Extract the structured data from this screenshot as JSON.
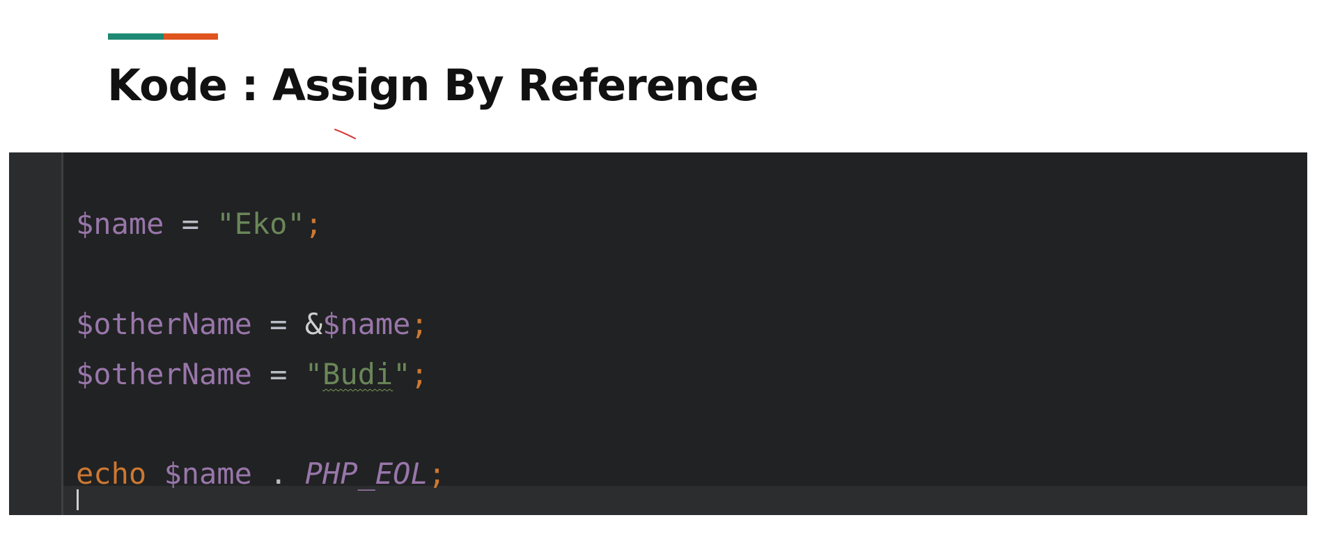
{
  "slide": {
    "title": "Kode : Assign By Reference",
    "accent_colors": [
      "#1f8a74",
      "#e0541f"
    ]
  },
  "editor": {
    "theme_bg": "#212223",
    "lines": [
      {
        "tokens": [
          {
            "type": "var",
            "text": "$name"
          },
          {
            "type": "op",
            "text": " = "
          },
          {
            "type": "str",
            "text": "\"Eko\""
          },
          {
            "type": "punc",
            "text": ";"
          }
        ]
      },
      {
        "tokens": [
          {
            "type": "var",
            "text": "$otherName"
          },
          {
            "type": "op",
            "text": " = "
          },
          {
            "type": "amp",
            "text": "&"
          },
          {
            "type": "var",
            "text": "$name"
          },
          {
            "type": "punc",
            "text": ";"
          }
        ]
      },
      {
        "tokens": [
          {
            "type": "var",
            "text": "$otherName"
          },
          {
            "type": "op",
            "text": " = "
          },
          {
            "type": "str",
            "text": "\""
          },
          {
            "type": "str_squiggle",
            "text": "Budi"
          },
          {
            "type": "str",
            "text": "\""
          },
          {
            "type": "punc",
            "text": ";"
          }
        ]
      },
      {
        "tokens": [
          {
            "type": "kw",
            "text": "echo"
          },
          {
            "type": "op",
            "text": " "
          },
          {
            "type": "var",
            "text": "$name"
          },
          {
            "type": "op",
            "text": " . "
          },
          {
            "type": "const",
            "text": "PHP_EOL"
          },
          {
            "type": "punc",
            "text": ";"
          }
        ]
      }
    ]
  },
  "colors": {
    "variable": "#9876aa",
    "string": "#6a8759",
    "keyword": "#cc7832",
    "operator": "#b8bcc4"
  }
}
